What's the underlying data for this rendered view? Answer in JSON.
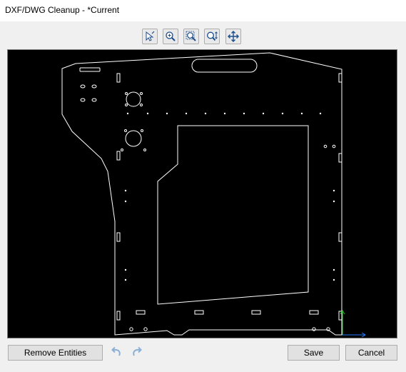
{
  "window": {
    "title": "DXF/DWG Cleanup - *Current"
  },
  "toolbar": {
    "tools": [
      {
        "icon": "select-cursor-icon"
      },
      {
        "icon": "zoom-in-icon"
      },
      {
        "icon": "zoom-fit-icon"
      },
      {
        "icon": "zoom-dynamic-icon"
      },
      {
        "icon": "pan-move-icon"
      }
    ]
  },
  "drawing": {
    "background": "#000000",
    "stroke": "#ffffff",
    "axis_x_color": "#1f7bff",
    "axis_y_color": "#22c322"
  },
  "footer": {
    "remove_label": "Remove Entities",
    "undo_icon": "undo-icon",
    "redo_icon": "redo-icon",
    "save_label": "Save",
    "cancel_label": "Cancel"
  }
}
